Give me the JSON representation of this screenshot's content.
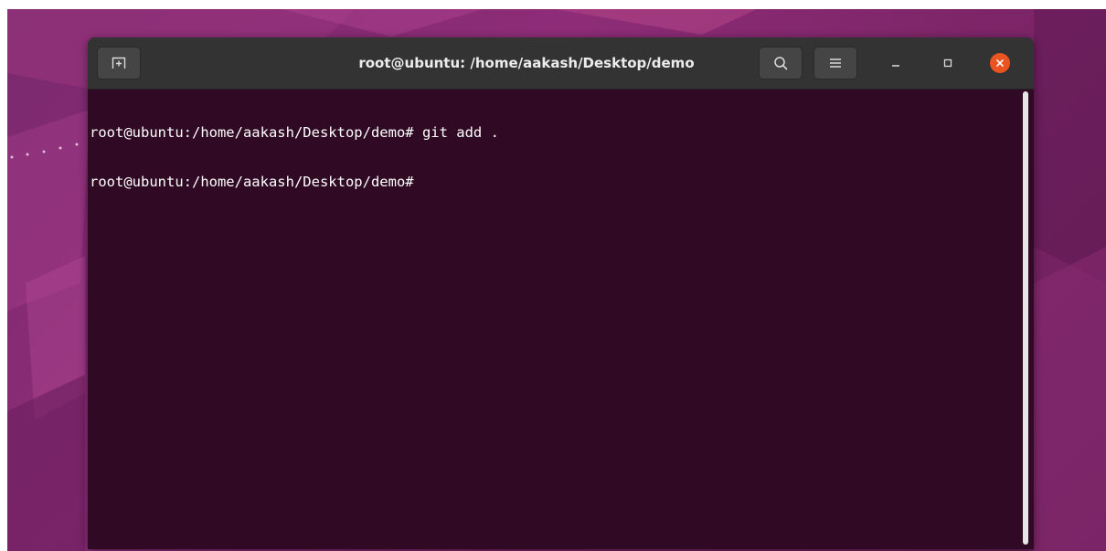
{
  "window": {
    "title": "root@ubuntu: /home/aakash/Desktop/demo"
  },
  "toolbar": {
    "new_tab_icon": "new-tab-icon",
    "search_icon": "search-icon",
    "menu_icon": "hamburger-menu-icon",
    "minimize_icon": "minimize-icon",
    "maximize_icon": "maximize-icon",
    "close_icon": "close-icon"
  },
  "terminal": {
    "lines": [
      "root@ubuntu:/home/aakash/Desktop/demo# git add .",
      "root@ubuntu:/home/aakash/Desktop/demo#"
    ]
  },
  "colors": {
    "terminal_bg": "#300a24",
    "titlebar_bg": "#333333",
    "close_button": "#e95420",
    "text": "#ffffff"
  }
}
